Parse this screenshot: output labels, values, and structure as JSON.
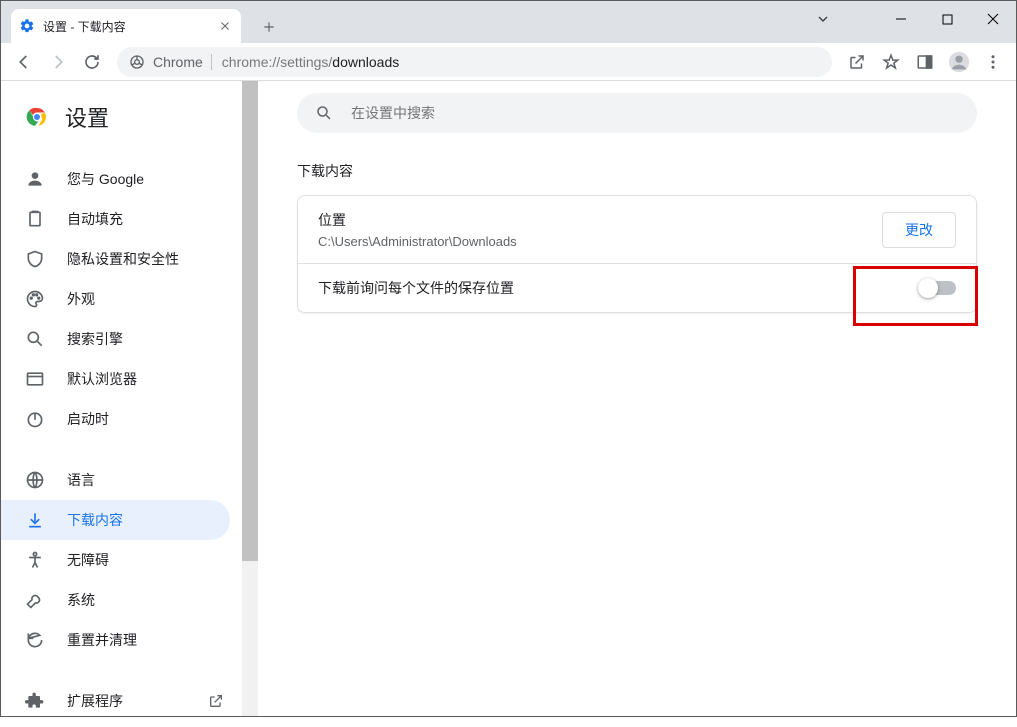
{
  "window": {
    "tab_title": "设置 - 下载内容"
  },
  "omnibox": {
    "scheme_label": "Chrome",
    "url_dim": "chrome://settings/",
    "url_path": "downloads"
  },
  "settings_header": "设置",
  "search": {
    "placeholder": "在设置中搜索"
  },
  "sidebar": {
    "items": [
      {
        "label": "您与 Google"
      },
      {
        "label": "自动填充"
      },
      {
        "label": "隐私设置和安全性"
      },
      {
        "label": "外观"
      },
      {
        "label": "搜索引擎"
      },
      {
        "label": "默认浏览器"
      },
      {
        "label": "启动时"
      },
      {
        "label": "语言"
      },
      {
        "label": "下载内容"
      },
      {
        "label": "无障碍"
      },
      {
        "label": "系统"
      },
      {
        "label": "重置并清理"
      },
      {
        "label": "扩展程序"
      }
    ]
  },
  "main": {
    "section_title": "下载内容",
    "location": {
      "label": "位置",
      "path": "C:\\Users\\Administrator\\Downloads",
      "change_btn": "更改"
    },
    "ask_row": {
      "label": "下载前询问每个文件的保存位置",
      "value": false
    }
  }
}
